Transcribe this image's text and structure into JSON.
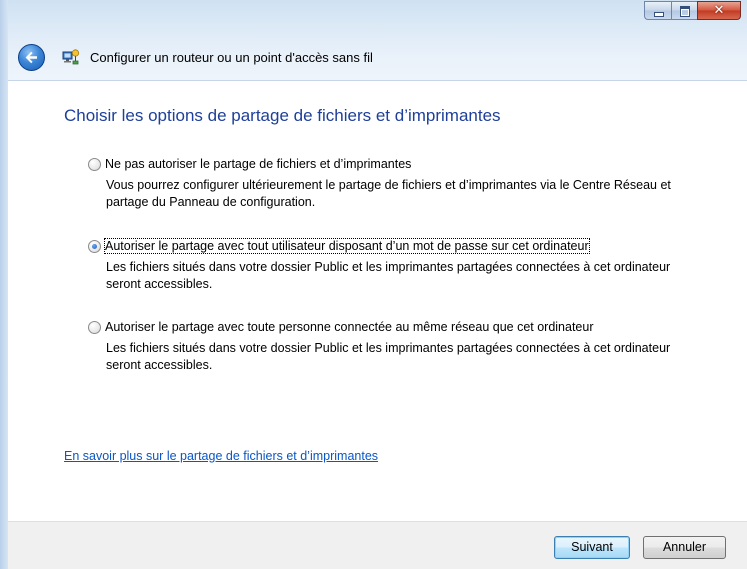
{
  "window": {
    "title": "Configurer un routeur ou un point d'accès sans fil",
    "caption_buttons": {
      "minimize_icon": "minimize-icon",
      "maximize_icon": "maximize-icon",
      "close_glyph": "✕"
    }
  },
  "header": {
    "back_icon": "back-arrow-icon",
    "wizard_icon": "network-wizard-icon"
  },
  "main": {
    "title": "Choisir les options de partage de fichiers et d’imprimantes",
    "options": [
      {
        "label": "Ne pas autoriser le partage de fichiers et d’imprimantes",
        "description": "Vous pourrez configurer ultérieurement le partage de fichiers et d’imprimantes via le Centre Réseau et partage du Panneau de configuration.",
        "selected": false
      },
      {
        "label": "Autoriser le partage avec tout utilisateur disposant d’un mot de passe sur cet ordinateur",
        "description": "Les fichiers situés dans votre dossier Public et les imprimantes partagées connectées à cet ordinateur seront accessibles.",
        "selected": true
      },
      {
        "label": "Autoriser le partage avec toute personne connectée au même réseau que cet ordinateur",
        "description": "Les fichiers situés dans votre dossier Public et les imprimantes partagées connectées à cet ordinateur seront accessibles.",
        "selected": false
      }
    ],
    "learn_more_link": "En savoir plus sur le partage de fichiers et d’imprimantes"
  },
  "footer": {
    "next_label": "Suivant",
    "cancel_label": "Annuler"
  },
  "colors": {
    "title_blue": "#1e3f9a",
    "link_blue": "#0b56c4",
    "close_red": "#c23a22"
  }
}
